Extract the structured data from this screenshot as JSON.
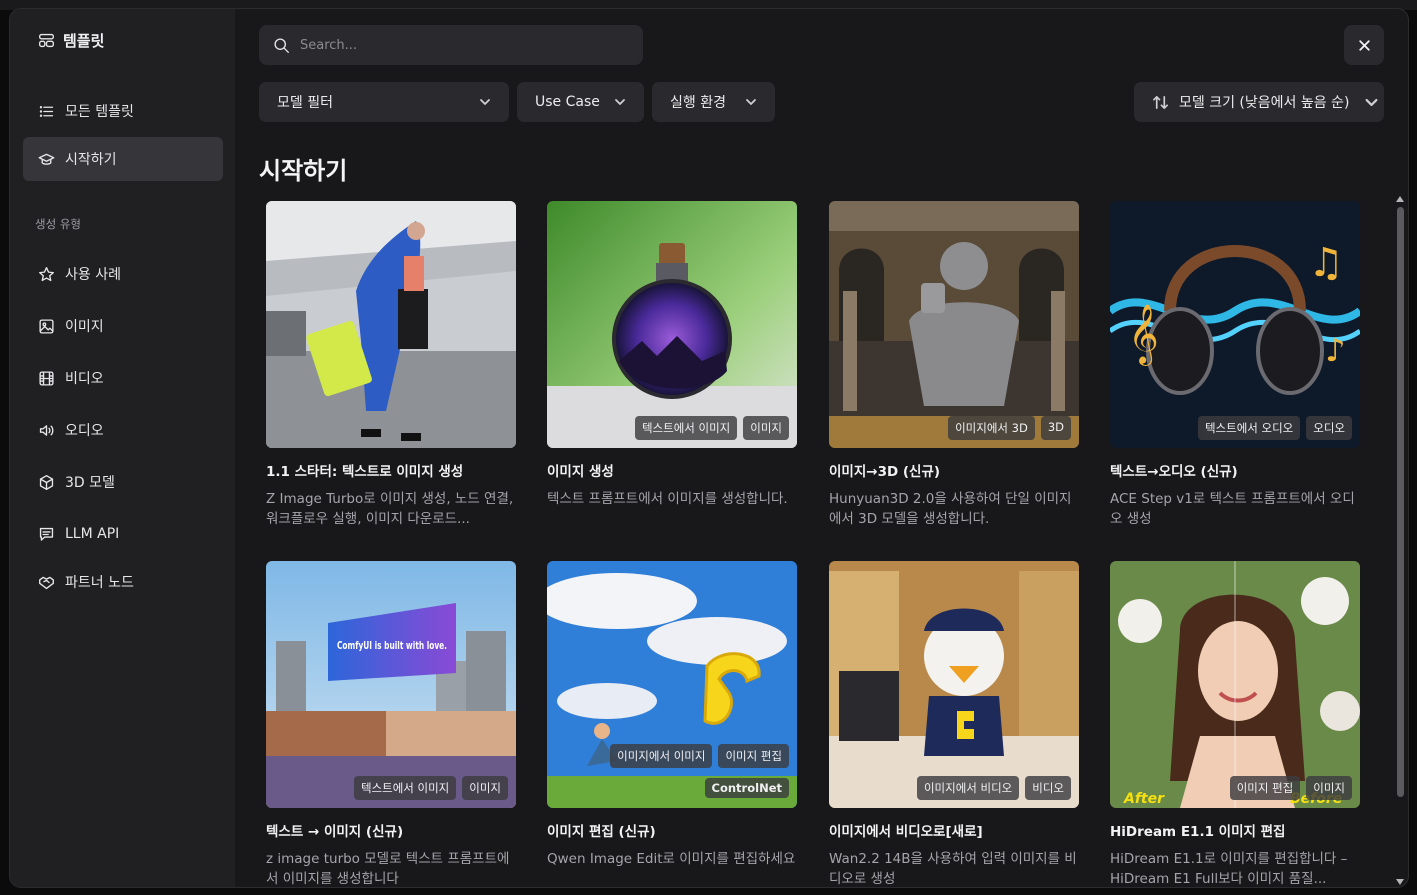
{
  "sidebar": {
    "brand": "템플릿",
    "items": [
      {
        "label": "모든 템플릿",
        "icon": "list-icon"
      },
      {
        "label": "시작하기",
        "icon": "graduation-cap-icon",
        "active": true
      }
    ],
    "section_label": "생성 유형",
    "section_items": [
      {
        "label": "사용 사례",
        "icon": "star-icon"
      },
      {
        "label": "이미지",
        "icon": "image-icon"
      },
      {
        "label": "비디오",
        "icon": "film-icon"
      },
      {
        "label": "오디오",
        "icon": "speaker-icon"
      },
      {
        "label": "3D 모델",
        "icon": "cube-icon"
      },
      {
        "label": "LLM API",
        "icon": "message-icon"
      },
      {
        "label": "파트너 노드",
        "icon": "handshake-icon"
      }
    ]
  },
  "search": {
    "placeholder": "Search..."
  },
  "filters": {
    "model": "모델 필터",
    "use_case": "Use Case",
    "runtime": "실행 환경"
  },
  "sort": {
    "label": "모델 크기 (낮음에서 높음 순)"
  },
  "page_title": "시작하기",
  "cards": [
    {
      "title": "1.1 스타터: 텍스트로 이미지 생성",
      "desc": "Z Image Turbo로 이미지 생성, 노드 연결, 워크플로우 실행, 이미지 다운로드...",
      "badges": []
    },
    {
      "title": "이미지 생성",
      "desc": "텍스트 프롬프트에서 이미지를 생성합니다.",
      "badges": [
        "텍스트에서 이미지",
        "이미지"
      ]
    },
    {
      "title": "이미지→3D (신규)",
      "desc": "Hunyuan3D 2.0을 사용하여 단일 이미지에서 3D 모델을 생성합니다.",
      "badges": [
        "이미지에서 3D",
        "3D"
      ]
    },
    {
      "title": "텍스트→오디오 (신규)",
      "desc": "ACE Step v1로 텍스트 프롬프트에서 오디오 생성",
      "badges": [
        "텍스트에서 오디오",
        "오디오"
      ]
    },
    {
      "title": "텍스트 → 이미지 (신규)",
      "desc": "z image turbo 모델로 텍스트 프롬프트에서 이미지를 생성합니다",
      "badges": [
        "텍스트에서 이미지",
        "이미지"
      ],
      "billboard": "ComfyUI is built with love."
    },
    {
      "title": "이미지 편집 (신규)",
      "desc": "Qwen Image Edit로 이미지를 편집하세요",
      "badges": [
        "이미지에서 이미지",
        "이미지 편집"
      ],
      "extra_badge": "ControlNet"
    },
    {
      "title": "이미지에서 비디오로[새로]",
      "desc": "Wan2.2 14B을 사용하여 입력 이미지를 비디오로 생성",
      "badges": [
        "이미지에서 비디오",
        "비디오"
      ]
    },
    {
      "title": "HiDream E1.1 이미지 편집",
      "desc": "HiDream E1.1로 이미지를 편집합니다 – HiDream E1 Full보다 이미지 품질...",
      "badges": [
        "이미지 편집",
        "이미지"
      ],
      "overlay_after": "After",
      "overlay_before": "Before"
    }
  ],
  "colors": {
    "modal_bg": "#18181a",
    "sidebar_bg": "#202023",
    "control_bg": "#2a2a2e",
    "active_bg": "#35353a"
  }
}
